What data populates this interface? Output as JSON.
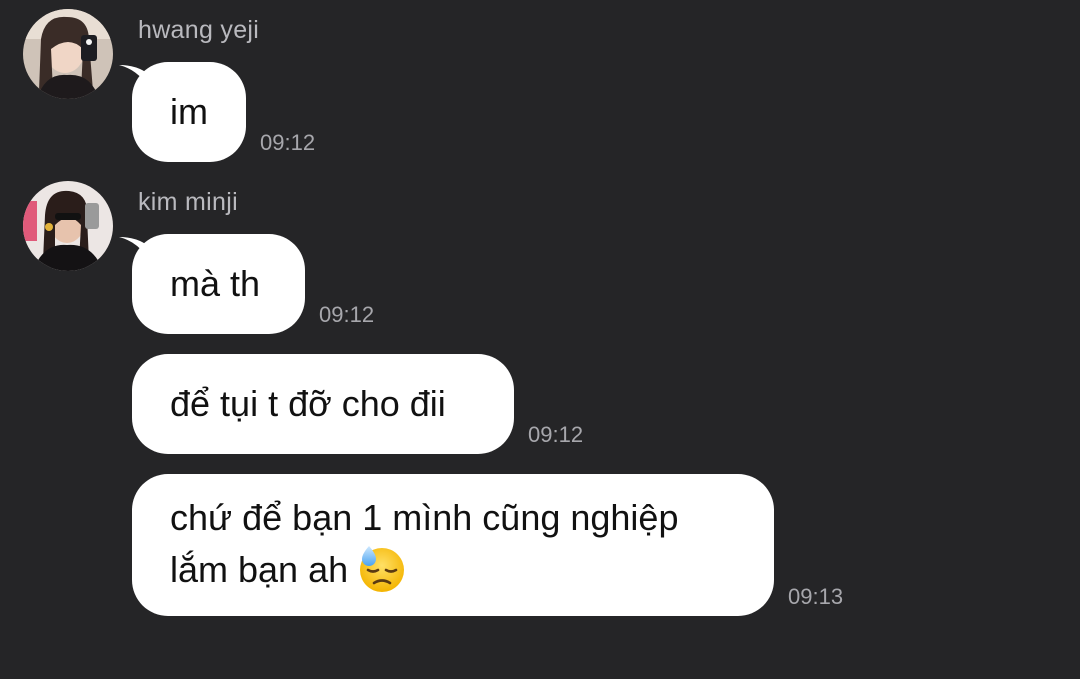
{
  "chat": {
    "groups": [
      {
        "sender": "hwang yeji",
        "messages": [
          {
            "text": "im",
            "time": "09:12"
          }
        ]
      },
      {
        "sender": "kim minji",
        "messages": [
          {
            "text": "mà th",
            "time": "09:12"
          },
          {
            "text": "để tụi t đỡ cho đii",
            "time": "09:12"
          },
          {
            "line1": "chứ để bạn 1 mình cũng nghiệp",
            "line2": "lắm bạn ah",
            "emoji": "downcast-face-with-sweat-icon",
            "time": "09:13"
          }
        ]
      }
    ]
  },
  "colors": {
    "background": "#252527",
    "bubble": "#ffffff",
    "sender_name": "#b9b9be",
    "timestamp": "#a7a7ac"
  }
}
